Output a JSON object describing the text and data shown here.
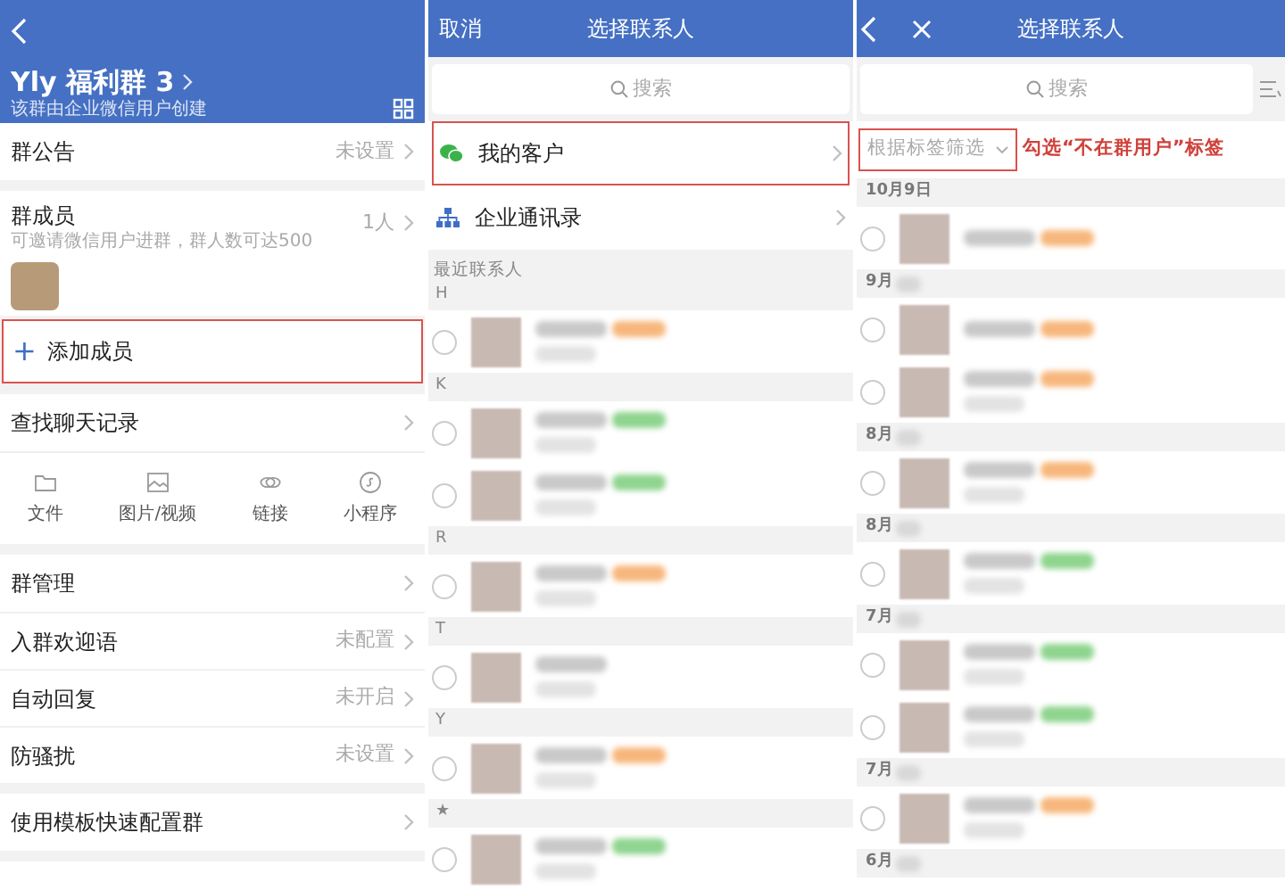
{
  "group_info": {
    "title": "Yly 福利群 3",
    "subtitle": "该群由企业微信用户创建",
    "announcement": {
      "label": "群公告",
      "value": "未设置"
    },
    "members": {
      "label": "群成员",
      "hint": "可邀请微信用户进群，群人数可达500",
      "count": "1人"
    },
    "add_member": {
      "icon": "+",
      "label": "添加成员",
      "highlighted": true
    },
    "search_history": {
      "label": "查找聊天记录"
    },
    "media_types": [
      {
        "kind": "folder",
        "label": "文件"
      },
      {
        "kind": "image",
        "label": "图片/视频"
      },
      {
        "kind": "link",
        "label": "链接"
      },
      {
        "kind": "miniapp",
        "label": "小程序"
      }
    ],
    "settings": [
      {
        "label": "群管理"
      },
      {
        "label": "入群欢迎语",
        "value": "未配置"
      },
      {
        "label": "自动回复",
        "value": "未开启"
      },
      {
        "label": "防骚扰",
        "value": "未设置"
      }
    ],
    "template": {
      "label": "使用模板快速配置群"
    }
  },
  "select_contacts": {
    "cancel": "取消",
    "title": "选择联系人",
    "search_placeholder": "搜索",
    "entries": [
      {
        "kind": "wechat",
        "label": "我的客户",
        "highlighted": true
      },
      {
        "kind": "org",
        "label": "企业通讯录",
        "highlighted": false
      }
    ],
    "recent_label": "最近联系人",
    "sections": [
      {
        "letter": "H",
        "contacts": [
          {
            "selected": false,
            "color": "#f7b77c"
          }
        ]
      },
      {
        "letter": "K",
        "contacts": [
          {
            "selected": false,
            "color": "#8fd48f"
          },
          {
            "selected": false,
            "color": "#8fd48f"
          }
        ]
      },
      {
        "letter": "R",
        "contacts": [
          {
            "selected": false,
            "color": "#f7b77c"
          }
        ]
      },
      {
        "letter": "T",
        "contacts": [
          {
            "selected": false
          }
        ]
      },
      {
        "letter": "Y",
        "contacts": [
          {
            "selected": false,
            "color": "#f7b77c"
          }
        ]
      },
      {
        "letter": "★",
        "contacts": [
          {
            "selected": false,
            "color": "#8fd48f"
          }
        ]
      }
    ]
  },
  "customer_list": {
    "title": "选择联系人",
    "search_placeholder": "搜索",
    "filter": {
      "label": "根据标签筛选",
      "highlighted": true
    },
    "annotation": "勾选“不在群用户”标签",
    "groups": [
      {
        "date": "10月9日",
        "obscured": false,
        "contacts": [
          {
            "selected": false,
            "color": "#f7b77c"
          }
        ]
      },
      {
        "date": "9月",
        "obscured": true,
        "contacts": [
          {
            "selected": false,
            "color": "#f7b77c"
          },
          {
            "selected": false,
            "color": "#f7b77c"
          }
        ]
      },
      {
        "date": "8月",
        "obscured": true,
        "contacts": [
          {
            "selected": false,
            "color": "#f7b77c"
          }
        ]
      },
      {
        "date": "8月",
        "obscured": true,
        "contacts": [
          {
            "selected": false,
            "color": "#8fd48f"
          }
        ]
      },
      {
        "date": "7月",
        "obscured": true,
        "contacts": [
          {
            "selected": false,
            "color": "#8fd48f"
          },
          {
            "selected": false,
            "color": "#8fd48f"
          }
        ]
      },
      {
        "date": "7月",
        "obscured": true,
        "contacts": [
          {
            "selected": false,
            "color": "#f7b77c"
          }
        ]
      },
      {
        "date": "6月",
        "obscured": true
      }
    ]
  }
}
